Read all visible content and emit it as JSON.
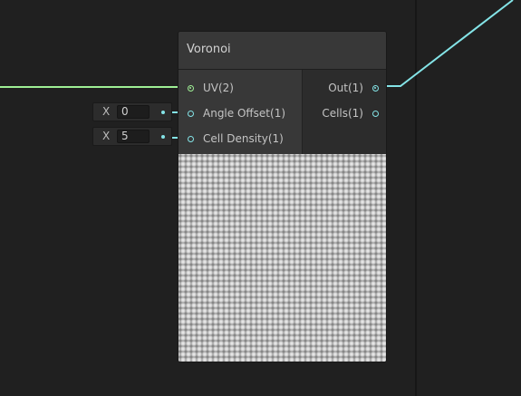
{
  "node": {
    "title": "Voronoi",
    "inputs": [
      {
        "label": "UV(2)"
      },
      {
        "label": "Angle Offset(1)"
      },
      {
        "label": "Cell Density(1)"
      }
    ],
    "outputs": [
      {
        "label": "Out(1)"
      },
      {
        "label": "Cells(1)"
      }
    ]
  },
  "fields": [
    {
      "axis": "X",
      "value": "0"
    },
    {
      "axis": "X",
      "value": "5"
    }
  ],
  "colors": {
    "background": "#202020",
    "uv_wire": "#9fef95",
    "float_wire": "#84e4e7"
  }
}
